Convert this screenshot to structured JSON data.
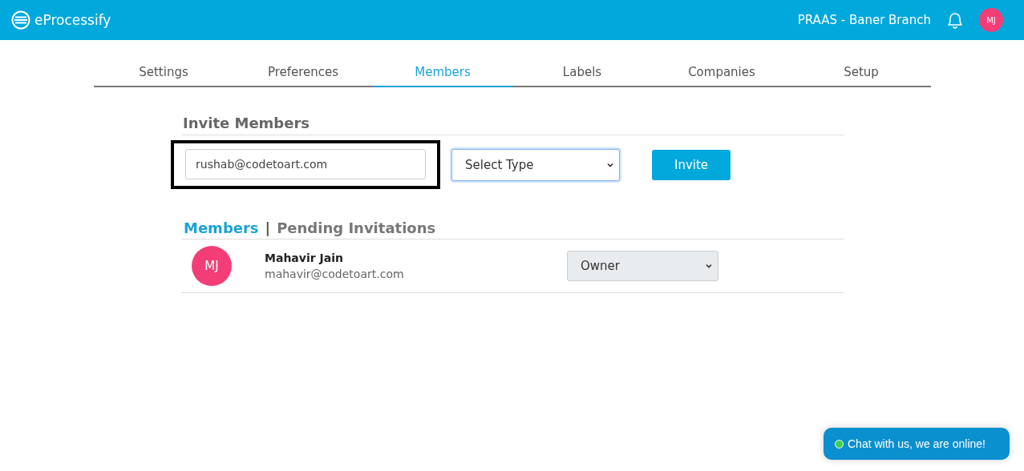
{
  "header": {
    "brand": "eProcessify",
    "branch": "PRAAS - Baner Branch",
    "avatar": "MJ"
  },
  "tabs": [
    {
      "label": "Settings",
      "selected": false
    },
    {
      "label": "Preferences",
      "selected": false
    },
    {
      "label": "Members",
      "selected": true
    },
    {
      "label": "Labels",
      "selected": false
    },
    {
      "label": "Companies",
      "selected": false
    },
    {
      "label": "Setup",
      "selected": false
    }
  ],
  "invite": {
    "title": "Invite Members",
    "email": "rushab@codetoart.com",
    "email_highlighted": true,
    "type_select": "Select Type",
    "type_focused": true,
    "button": "Invite"
  },
  "list_tabs": [
    {
      "label": "Members",
      "selected": true
    },
    {
      "label": "Pending Invitations",
      "selected": false
    }
  ],
  "separator": "|",
  "members": [
    {
      "initials": "MJ",
      "name": "Mahavir Jain",
      "email": "mahavir@codetoart.com",
      "role": "Owner"
    }
  ],
  "chat": {
    "label": "Chat with us, we are online!",
    "online": true
  }
}
